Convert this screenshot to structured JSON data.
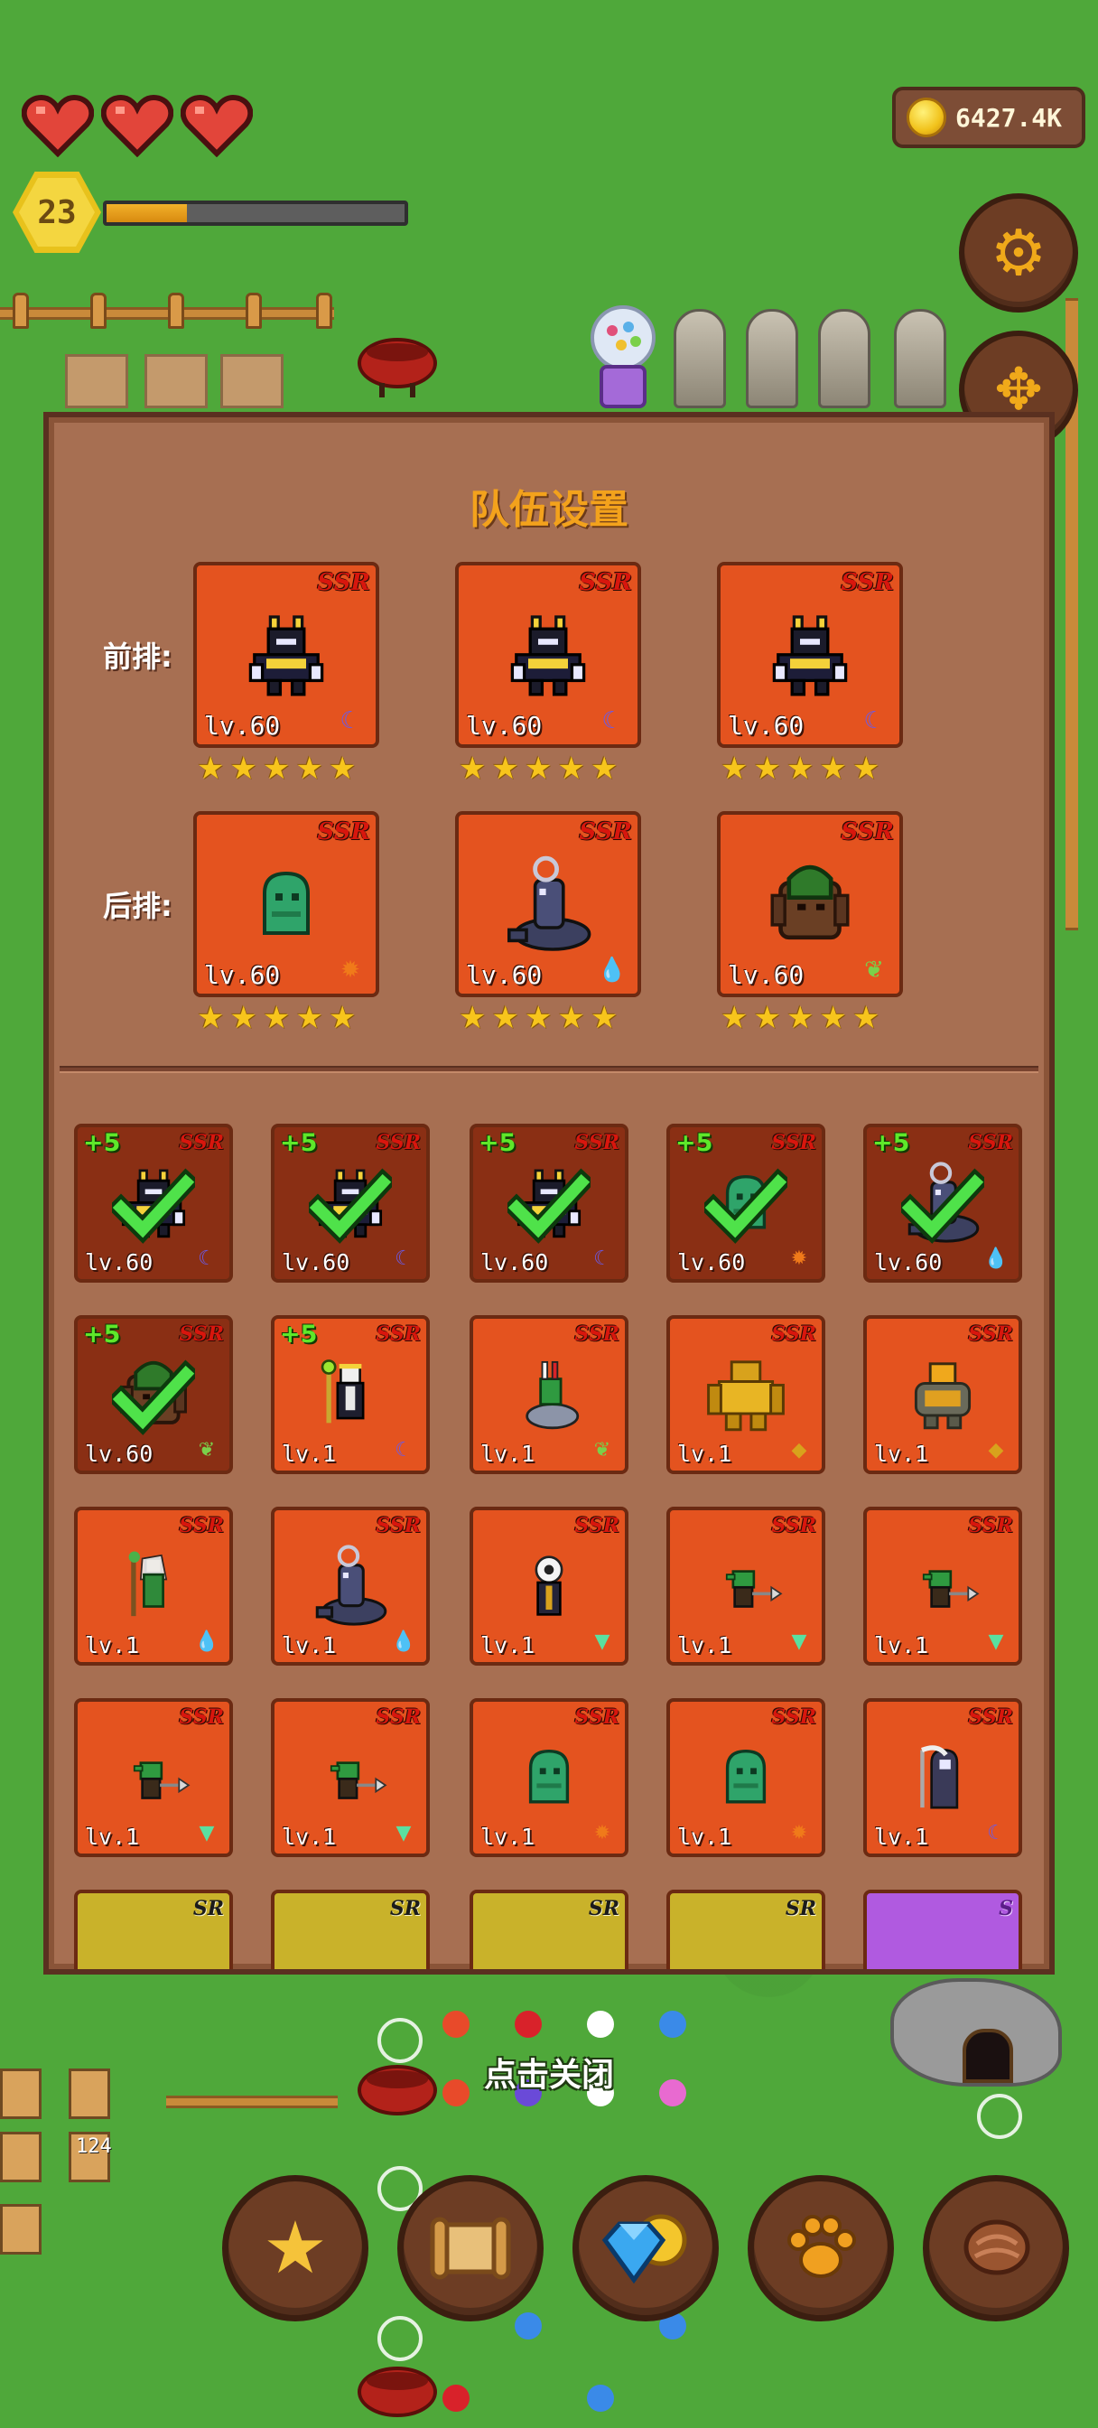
{
  "hud": {
    "hearts": 3,
    "player_level": "23",
    "xp_progress": 0.27,
    "coins": "6427.4K"
  },
  "panel": {
    "title": "队伍设置",
    "front_label": "前排:",
    "back_label": "后排:",
    "front": [
      {
        "rarity": "SSR",
        "level": "lv.60",
        "stars": 5,
        "unit": "dark-knight",
        "element": "moon"
      },
      {
        "rarity": "SSR",
        "level": "lv.60",
        "stars": 5,
        "unit": "dark-knight",
        "element": "moon"
      },
      {
        "rarity": "SSR",
        "level": "lv.60",
        "stars": 5,
        "unit": "dark-knight",
        "element": "moon"
      }
    ],
    "back": [
      {
        "rarity": "SSR",
        "level": "lv.60",
        "stars": 5,
        "unit": "green-slime",
        "element": "sun"
      },
      {
        "rarity": "SSR",
        "level": "lv.60",
        "stars": 5,
        "unit": "wolf-rider",
        "element": "water"
      },
      {
        "rarity": "SSR",
        "level": "lv.60",
        "stars": 5,
        "unit": "treant",
        "element": "leaf"
      }
    ],
    "roster": [
      {
        "rarity": "SSR",
        "level": "lv.60",
        "plus": "+5",
        "selected": true,
        "unit": "dark-knight",
        "element": "moon"
      },
      {
        "rarity": "SSR",
        "level": "lv.60",
        "plus": "+5",
        "selected": true,
        "unit": "dark-knight",
        "element": "moon"
      },
      {
        "rarity": "SSR",
        "level": "lv.60",
        "plus": "+5",
        "selected": true,
        "unit": "dark-knight",
        "element": "moon"
      },
      {
        "rarity": "SSR",
        "level": "lv.60",
        "plus": "+5",
        "selected": true,
        "unit": "green-slime",
        "element": "sun"
      },
      {
        "rarity": "SSR",
        "level": "lv.60",
        "plus": "+5",
        "selected": true,
        "unit": "wolf-rider",
        "element": "water"
      },
      {
        "rarity": "SSR",
        "level": "lv.60",
        "plus": "+5",
        "selected": true,
        "unit": "treant",
        "element": "leaf"
      },
      {
        "rarity": "SSR",
        "level": "lv.1",
        "plus": "+5",
        "selected": false,
        "unit": "skeleton-mage",
        "element": "moon"
      },
      {
        "rarity": "SSR",
        "level": "lv.1",
        "plus": "",
        "selected": false,
        "unit": "goblin-rider",
        "element": "leaf"
      },
      {
        "rarity": "SSR",
        "level": "lv.1",
        "plus": "",
        "selected": false,
        "unit": "gold-golem",
        "element": "earth"
      },
      {
        "rarity": "SSR",
        "level": "lv.1",
        "plus": "",
        "selected": false,
        "unit": "stone-golem",
        "element": "earth"
      },
      {
        "rarity": "SSR",
        "level": "lv.1",
        "plus": "",
        "selected": false,
        "unit": "elf-druid",
        "element": "water"
      },
      {
        "rarity": "SSR",
        "level": "lv.1",
        "plus": "",
        "selected": false,
        "unit": "wolf-rider",
        "element": "water"
      },
      {
        "rarity": "SSR",
        "level": "lv.1",
        "plus": "",
        "selected": false,
        "unit": "eyeball-mage",
        "element": "wind"
      },
      {
        "rarity": "SSR",
        "level": "lv.1",
        "plus": "",
        "selected": false,
        "unit": "goblin",
        "element": "wind"
      },
      {
        "rarity": "SSR",
        "level": "lv.1",
        "plus": "",
        "selected": false,
        "unit": "goblin",
        "element": "wind"
      },
      {
        "rarity": "SSR",
        "level": "lv.1",
        "plus": "",
        "selected": false,
        "unit": "goblin",
        "element": "wind"
      },
      {
        "rarity": "SSR",
        "level": "lv.1",
        "plus": "",
        "selected": false,
        "unit": "goblin",
        "element": "wind"
      },
      {
        "rarity": "SSR",
        "level": "lv.1",
        "plus": "",
        "selected": false,
        "unit": "green-slime",
        "element": "sun"
      },
      {
        "rarity": "SSR",
        "level": "lv.1",
        "plus": "",
        "selected": false,
        "unit": "green-slime",
        "element": "sun"
      },
      {
        "rarity": "SSR",
        "level": "lv.1",
        "plus": "",
        "selected": false,
        "unit": "reaper",
        "element": "moon"
      },
      {
        "rarity": "SR",
        "level": "",
        "plus": "",
        "selected": false,
        "unit": "unknown",
        "element": ""
      },
      {
        "rarity": "SR",
        "level": "",
        "plus": "",
        "selected": false,
        "unit": "unknown",
        "element": ""
      },
      {
        "rarity": "SR",
        "level": "",
        "plus": "",
        "selected": false,
        "unit": "unknown",
        "element": ""
      },
      {
        "rarity": "SR",
        "level": "",
        "plus": "",
        "selected": false,
        "unit": "unknown",
        "element": ""
      },
      {
        "rarity": "S",
        "level": "",
        "plus": "",
        "selected": false,
        "unit": "unknown",
        "element": ""
      }
    ]
  },
  "close_hint": "点击关闭",
  "map_badge": "124",
  "side_buttons": [
    "gear-icon",
    "move-arrows-icon"
  ],
  "bottom_nav": [
    {
      "name": "favorites",
      "icon": "star-icon"
    },
    {
      "name": "map",
      "icon": "scroll-icon"
    },
    {
      "name": "shop",
      "icon": "gem-coin-icon"
    },
    {
      "name": "pets",
      "icon": "paw-icon"
    },
    {
      "name": "food",
      "icon": "meat-icon"
    }
  ],
  "colors": {
    "grass": "#4fa83a",
    "panel": "#a76f52",
    "card_ssr": "#e4531f",
    "card_sr": "#c9b22a",
    "card_s": "#b05ae0",
    "title": "#f3a21c",
    "check": "#4fe24a"
  }
}
